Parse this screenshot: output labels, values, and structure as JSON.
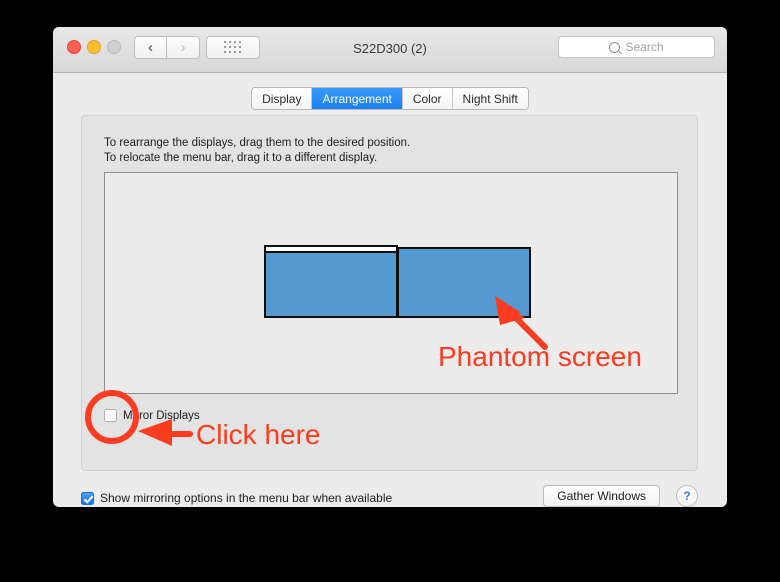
{
  "window": {
    "title": "S22D300 (2)",
    "traffic_lights": [
      "close",
      "minimize",
      "zoom"
    ],
    "nav": {
      "back_icon": "chevron-left-icon",
      "forward_icon": "chevron-right-icon",
      "show_all_icon": "grid-dots-icon"
    },
    "search": {
      "placeholder": "Search",
      "icon": "search-icon"
    }
  },
  "tabs": [
    {
      "label": "Display",
      "active": false
    },
    {
      "label": "Arrangement",
      "active": true
    },
    {
      "label": "Color",
      "active": false
    },
    {
      "label": "Night Shift",
      "active": false
    }
  ],
  "panel": {
    "instruction_line1": "To rearrange the displays, drag them to the desired position.",
    "instruction_line2": "To relocate the menu bar, drag it to a different display.",
    "displays": [
      {
        "name": "primary-display",
        "has_menu_bar": true
      },
      {
        "name": "phantom-display",
        "has_menu_bar": false
      }
    ],
    "mirror_displays": {
      "label": "Mirror Displays",
      "checked": false
    }
  },
  "bottom": {
    "show_mirroring": {
      "label": "Show mirroring options in the menu bar when available",
      "checked": true
    },
    "gather_windows_label": "Gather Windows",
    "help_label": "?"
  },
  "annotations": [
    {
      "id": "phantom",
      "text": "Phantom screen",
      "color": "#fa3c20"
    },
    {
      "id": "click",
      "text": "Click here",
      "color": "#fa3c20"
    }
  ],
  "colors": {
    "display_blue": "#5499d0",
    "tab_active_blue": "#1a7ef0",
    "annotation_red": "#fa3c20",
    "window_bg": "#ececec",
    "panel_bg": "#e3e3e3",
    "backdrop": "#000000"
  }
}
